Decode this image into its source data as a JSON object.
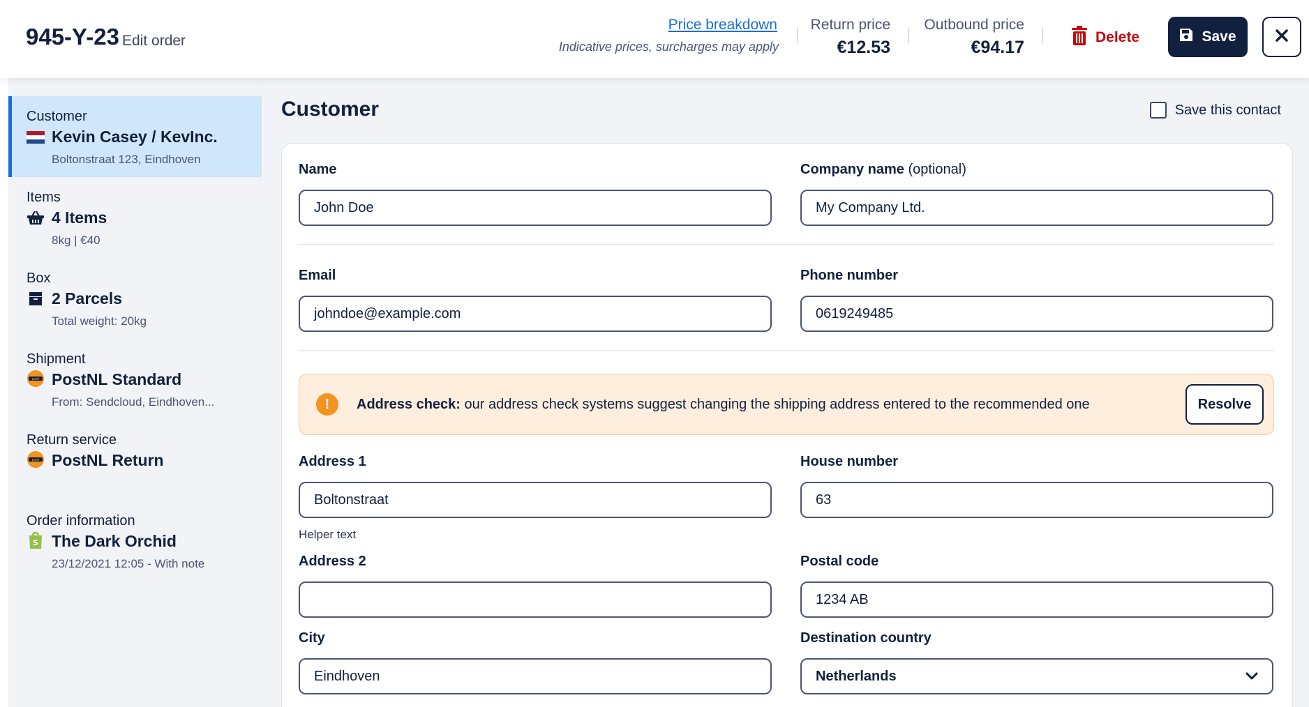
{
  "header": {
    "order_id": "945-Y-23",
    "edit_label": "Edit order",
    "price_breakdown": "Price breakdown",
    "price_note": "Indicative prices, surcharges may apply",
    "return_price_label": "Return price",
    "return_price_value": "€12.53",
    "outbound_price_label": "Outbound price",
    "outbound_price_value": "€94.17",
    "delete_label": "Delete",
    "save_label": "Save"
  },
  "sidebar": {
    "items": [
      {
        "category": "Customer",
        "title": "Kevin Casey / KevInc.",
        "subtitle": "Boltonstraat 123, Eindhoven",
        "icon": "netherlands-flag-icon"
      },
      {
        "category": "Items",
        "title": "4 Items",
        "subtitle": "8kg  |  €40",
        "icon": "basket-icon"
      },
      {
        "category": "Box",
        "title": "2 Parcels",
        "subtitle": "Total weight: 20kg",
        "icon": "box-icon"
      },
      {
        "category": "Shipment",
        "title": "PostNL Standard",
        "subtitle": "From: Sendcloud, Eindhoven...",
        "icon": "postnl-icon"
      },
      {
        "category": "Return service",
        "title": "PostNL Return",
        "icon": "postnl-icon"
      },
      {
        "category": "Order information",
        "title": "The Dark Orchid",
        "subtitle": "23/12/2021 12:05 - With note",
        "icon": "shopify-icon"
      }
    ]
  },
  "main": {
    "title": "Customer",
    "save_contact_label": "Save this contact",
    "fields": {
      "name": {
        "label": "Name",
        "value": "John Doe"
      },
      "company": {
        "label": "Company name",
        "optional": "(optional)",
        "value": "My Company Ltd."
      },
      "email": {
        "label": "Email",
        "value": "johndoe@example.com"
      },
      "phone": {
        "label": "Phone number",
        "value": "0619249485"
      },
      "address1": {
        "label": "Address 1",
        "value": "Boltonstraat",
        "helper": "Helper text"
      },
      "house_number": {
        "label": "House number",
        "value": "63"
      },
      "address2": {
        "label": "Address 2",
        "value": ""
      },
      "postal_code": {
        "label": "Postal code",
        "value": "1234 AB"
      },
      "city": {
        "label": "City",
        "value": "Eindhoven"
      },
      "country": {
        "label": "Destination country",
        "value": "Netherlands"
      }
    },
    "alert": {
      "title": "Address check:",
      "message": "our address check systems suggest changing the shipping address entered to the recommended one",
      "action": "Resolve"
    }
  },
  "colors": {
    "navy": "#12203f",
    "link": "#1b6ed6",
    "danger": "#c40d0d",
    "active_bg": "#cfe6fb",
    "warning_bg": "#fdeede",
    "warning_icon": "#f39320"
  }
}
